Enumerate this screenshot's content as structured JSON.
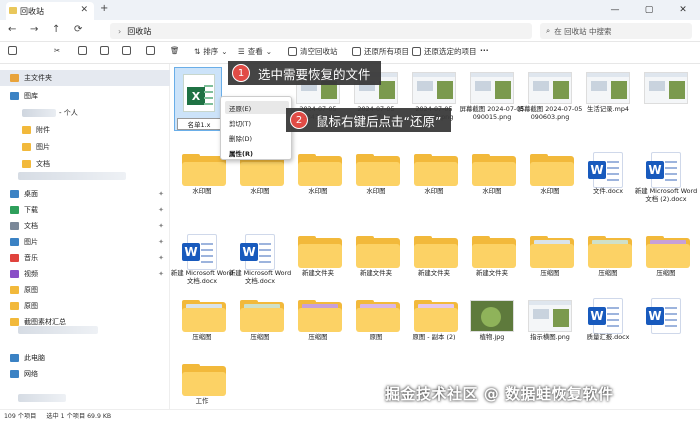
{
  "tab": {
    "title": "回收站"
  },
  "address": {
    "path": "回收站",
    "search_placeholder": "在 回收站 中搜索"
  },
  "toolbar": {
    "sort": "排序",
    "view": "查看",
    "empty": "清空回收站",
    "restore_all": "还原所有项目",
    "restore_selected": "还原选定的项目"
  },
  "sidebar": {
    "items": [
      {
        "label": "主文件夹",
        "color": "#e8a33b",
        "pin": false
      },
      {
        "label": "图库",
        "color": "#3b82c4",
        "pin": false
      },
      {
        "label": "- 个人",
        "color": "#3b82c4",
        "pin": false
      },
      {
        "label": "附件",
        "color": "#f2b93b",
        "pin": false
      },
      {
        "label": "图片",
        "color": "#f2b93b",
        "pin": false
      },
      {
        "label": "文档",
        "color": "#f2b93b",
        "pin": false
      },
      {
        "label": "桌面",
        "color": "#3b82c4",
        "pin": true
      },
      {
        "label": "下载",
        "color": "#2e9f5b",
        "pin": true
      },
      {
        "label": "文档",
        "color": "#7a8899",
        "pin": true
      },
      {
        "label": "图片",
        "color": "#3b82c4",
        "pin": true
      },
      {
        "label": "音乐",
        "color": "#e0433d",
        "pin": true
      },
      {
        "label": "视频",
        "color": "#8a4fc7",
        "pin": true
      },
      {
        "label": "原图",
        "color": "#f2b93b",
        "pin": false
      },
      {
        "label": "原图",
        "color": "#f2b93b",
        "pin": false
      },
      {
        "label": "截图素材汇总",
        "color": "#f2b93b",
        "pin": false
      },
      {
        "label": "此电脑",
        "color": "#3b82c4",
        "pin": false
      },
      {
        "label": "网络",
        "color": "#3b82c4",
        "pin": false
      }
    ]
  },
  "selected_file": {
    "name": "名单1.x"
  },
  "context_menu": {
    "items": [
      "还原(E)",
      "剪切(T)",
      "删除(D)",
      "属性(R)"
    ]
  },
  "callouts": [
    {
      "num": "1",
      "text": "选中需要恢复的文件"
    },
    {
      "num": "2",
      "text": "鼠标右键后点击“还原”"
    }
  ],
  "files": [
    {
      "row": 0,
      "labels": [
        "",
        "",
        "2024-07-05 133434.png",
        "2024-07-05 163617.png",
        "2024-07-05 170155.png",
        "屏幕截图 2024-07-05 090015.png",
        "屏幕截图 2024-07-05 090603.png",
        "生活记录.mp4",
        ""
      ]
    },
    {
      "row": 1,
      "labels": [
        "水印图",
        "水印图",
        "水印图",
        "水印图",
        "水印图",
        "水印图",
        "水印图",
        "文件.docx",
        "新建 Microsoft Word 文档 (2).docx"
      ]
    },
    {
      "row": 2,
      "labels": [
        "新建 Microsoft Word 文档.docx",
        "新建 Microsoft Word 文档.docx",
        "新建文件夹",
        "新建文件夹",
        "新建文件夹",
        "新建文件夹",
        "压缩图",
        "压缩图",
        "压缩图"
      ]
    },
    {
      "row": 3,
      "labels": [
        "压缩图",
        "压缩图",
        "压缩图",
        "原图",
        "原图 - 副本 (2)",
        "植物.jpg",
        "指示横图.png",
        "质量汇报.docx",
        ""
      ]
    },
    {
      "row": 4,
      "labels": [
        "工作"
      ]
    }
  ],
  "status": {
    "count": "109 个项目",
    "selected": "选中 1 个项目 69.9 KB"
  },
  "watermark": "掘金技术社区 @ 数据蛙恢复软件"
}
